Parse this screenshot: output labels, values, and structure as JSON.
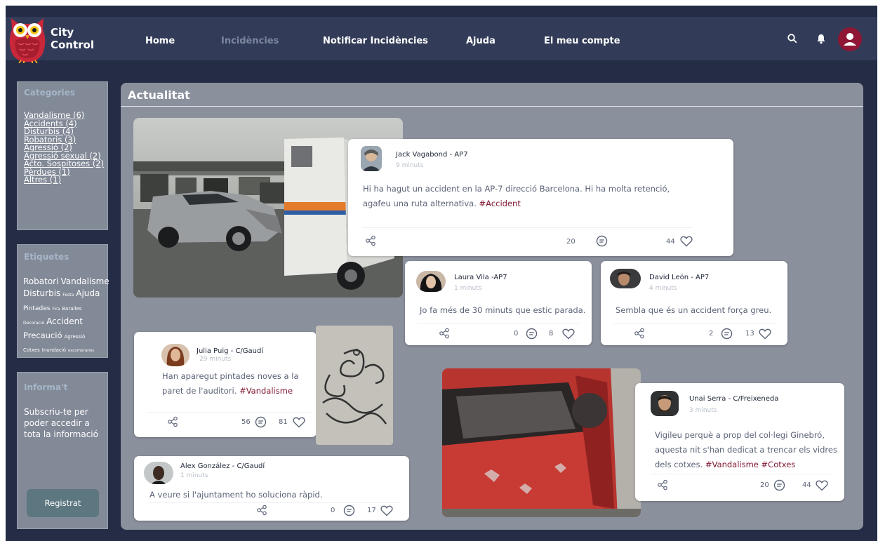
{
  "app": {
    "name_line1": "City",
    "name_line2": "Control"
  },
  "nav": {
    "home": "Home",
    "incidencies": "Incidències",
    "notificar": "Notificar Incidències",
    "ajuda": "Ajuda",
    "compte": "El meu compte",
    "active": "Incidències"
  },
  "header_icons": [
    "search-icon",
    "bell-icon",
    "user-icon"
  ],
  "colors": {
    "header": "#323c58",
    "background": "#242d45",
    "panel": "#8b909d",
    "accent": "#8f1634",
    "hashtag": "#7f1630"
  },
  "sidebar": {
    "categories_title": "Categories",
    "categories": [
      "Vandalisme (6)",
      "Accidents (4)",
      "Disturbis (4)",
      "Robatoris (3)",
      "Agressió (2)",
      "Agressió sexual (2)",
      "Acto. Sospitoses (2)",
      "Pèrdues (1)",
      "Altres (1) "
    ],
    "tags_title": "Etiquetes",
    "tags": [
      {
        "text": "Robatori",
        "size": "l"
      },
      {
        "text": "Vandalisme",
        "size": "l"
      },
      {
        "text": "Disturbis",
        "size": "l"
      },
      {
        "text": "Festa",
        "size": "xs"
      },
      {
        "text": "Ajuda",
        "size": "l"
      },
      {
        "text": "Pintades",
        "size": "m"
      },
      {
        "text": "Fira",
        "size": "xs"
      },
      {
        "text": "Baralles",
        "size": "s"
      },
      {
        "text": "Decoració",
        "size": "xs"
      },
      {
        "text": "Accident",
        "size": "l"
      },
      {
        "text": "Precaució",
        "size": "l"
      },
      {
        "text": "Agressió",
        "size": "s"
      },
      {
        "text": "Cotxes",
        "size": "s"
      },
      {
        "text": "Inundació",
        "size": "s"
      },
      {
        "text": "escombraries",
        "size": "xs"
      }
    ],
    "informat_title": "Informa't",
    "informat_text": "Subscriu-te per poder accedir a tota la informació",
    "register_button": "Registrat"
  },
  "main": {
    "title": "Actualitat",
    "posts": [
      {
        "author": "Jack Vagabond",
        "location": "AP7",
        "time": "9 minuts",
        "text": "Hi ha hagut un accident en la AP-7 direcció Barcelona. Hi ha molta retenció, agafeu una ruta alternativa.",
        "hashtags": "#Accident",
        "comments": "20",
        "likes": "44"
      },
      {
        "author": "Laura Vila",
        "location": "AP7",
        "time": "1 minuts",
        "text": "Jo fa més de 30 minuts que estic parada.",
        "comments": "0",
        "likes": "8"
      },
      {
        "author": "David León",
        "location": "AP7",
        "time": "4 minuts",
        "text": "Sembla que és un accident força greu.",
        "comments": "2",
        "likes": "13"
      },
      {
        "author": "Julia Puig",
        "location": "C/Gaudí",
        "time": "29 minuts",
        "text": "Han aparegut pintades noves a la paret de l'auditori.",
        "hashtags": "#Vandalisme",
        "comments": "56",
        "likes": "81"
      },
      {
        "author": "Alex González",
        "location": "C/Gaudí",
        "time": "1 minuts",
        "text": "A veure si l'ajuntament ho soluciona ràpid.",
        "comments": "0",
        "likes": "17"
      },
      {
        "author": "Unai Serra",
        "location": "C/Freixeneda",
        "time": "3 minuts",
        "text": "Vigileu perquè a prop del col·legi Ginebró, aquesta nit s'han dedicat a trencar els vidres dels cotxes.",
        "hashtags": "#Vandalisme #Cotxes",
        "comments": "20",
        "likes": "44"
      }
    ]
  }
}
